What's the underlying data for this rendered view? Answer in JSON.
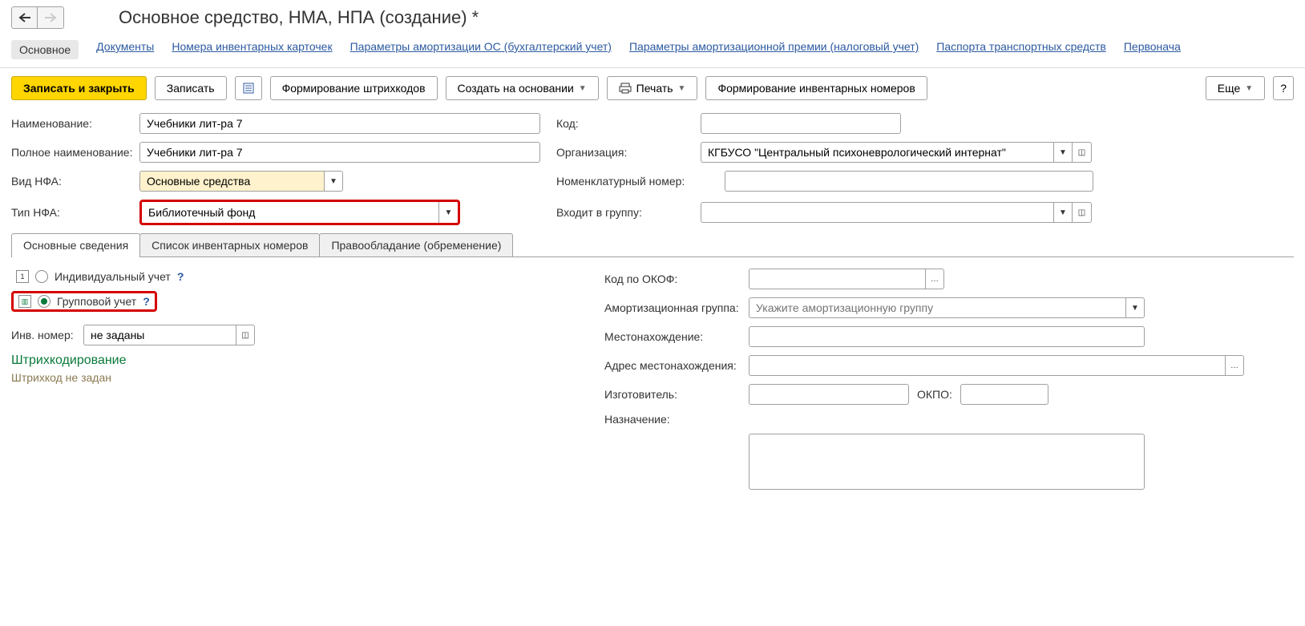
{
  "header": {
    "title": "Основное средство, НМА, НПА (создание) *"
  },
  "sections": [
    {
      "label": "Основное",
      "active": true
    },
    {
      "label": "Документы"
    },
    {
      "label": "Номера инвентарных карточек"
    },
    {
      "label": "Параметры амортизации ОС (бухгалтерский учет)"
    },
    {
      "label": "Параметры амортизационной премии (налоговый учет)"
    },
    {
      "label": "Паспорта транспортных средств"
    },
    {
      "label": "Первонача"
    }
  ],
  "toolbar": {
    "save_close": "Записать и закрыть",
    "save": "Записать",
    "barcodes": "Формирование штрихкодов",
    "create_based": "Создать на основании",
    "print": "Печать",
    "inv_numbers": "Формирование инвентарных номеров",
    "more": "Еще",
    "help": "?"
  },
  "fields": {
    "name_lbl": "Наименование:",
    "name_val": "Учебники лит-ра 7",
    "fullname_lbl": "Полное наименование:",
    "fullname_val": "Учебники лит-ра 7",
    "vidnfa_lbl": "Вид НФА:",
    "vidnfa_val": "Основные средства",
    "tipnfa_lbl": "Тип НФА:",
    "tipnfa_val": "Библиотечный фонд",
    "code_lbl": "Код:",
    "code_val": "",
    "org_lbl": "Организация:",
    "org_val": "КГБУСО \"Центральный психоневрологический интернат\"",
    "nom_lbl": "Номенклатурный номер:",
    "nom_val": "",
    "group_lbl": "Входит в группу:",
    "group_val": ""
  },
  "tabs": [
    {
      "label": "Основные сведения",
      "active": true
    },
    {
      "label": "Список инвентарных номеров"
    },
    {
      "label": "Правообладание (обременение)"
    }
  ],
  "pane": {
    "individual": "Индивидуальный учет",
    "group": "Групповой учет",
    "inv_lbl": "Инв. номер:",
    "inv_val": "не заданы",
    "barcode_title": "Штрихкодирование",
    "barcode_status": "Штрихкод не задан",
    "okof_lbl": "Код по ОКОФ:",
    "okof_val": "",
    "amort_lbl": "Амортизационная группа:",
    "amort_ph": "Укажите амортизационную группу",
    "loc_lbl": "Местонахождение:",
    "loc_val": "",
    "addr_lbl": "Адрес местонахождения:",
    "addr_val": "",
    "manuf_lbl": "Изготовитель:",
    "manuf_val": "",
    "okpo_lbl": "ОКПО:",
    "okpo_val": "",
    "purpose_lbl": "Назначение:",
    "purpose_val": ""
  }
}
